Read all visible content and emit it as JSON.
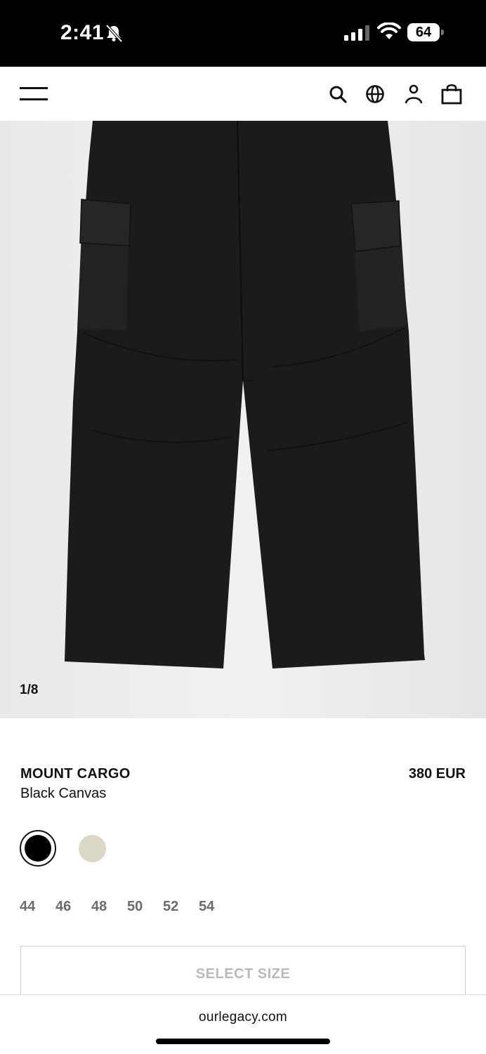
{
  "status_bar": {
    "time": "2:41",
    "battery": "64"
  },
  "icons": {
    "menu": "menu-icon",
    "search": "search-icon",
    "globe": "globe-icon",
    "account": "account-icon",
    "bag": "shopping-bag-icon"
  },
  "gallery": {
    "counter": "1/8"
  },
  "product": {
    "name": "MOUNT CARGO",
    "color_name": "Black Canvas",
    "price": "380 EUR",
    "swatches": [
      {
        "color": "#000000",
        "selected": true
      },
      {
        "color": "#dbd8c6",
        "selected": false
      }
    ],
    "sizes": [
      "44",
      "46",
      "48",
      "50",
      "52",
      "54"
    ],
    "select_size_label": "SELECT SIZE"
  },
  "browser": {
    "url": "ourlegacy.com"
  }
}
